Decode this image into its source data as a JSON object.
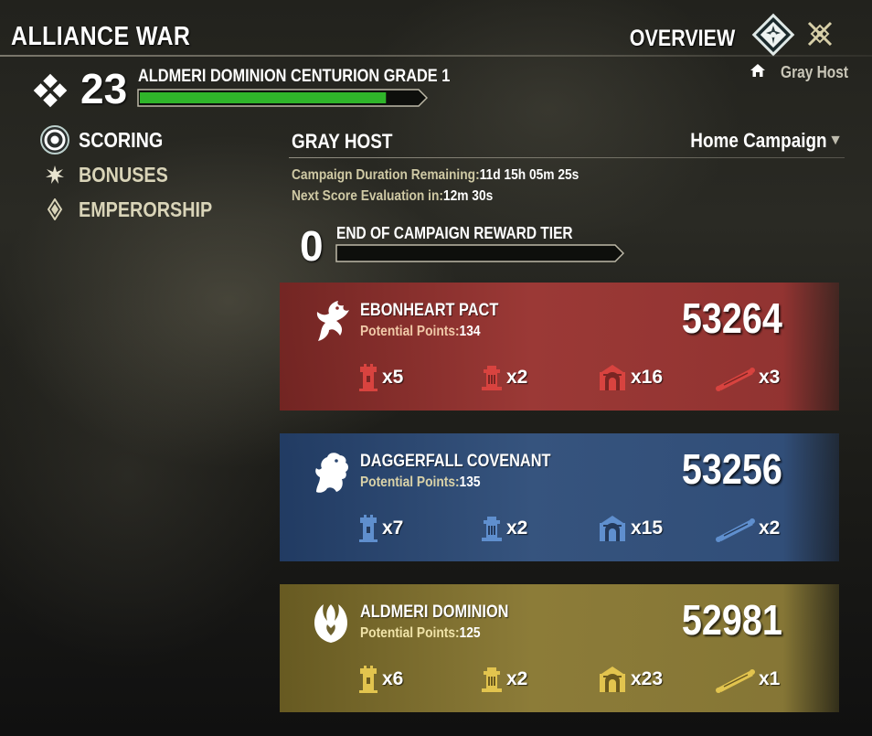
{
  "header": {
    "title": "ALLIANCE WAR",
    "overview_label": "OVERVIEW",
    "overview_icon": "overview-emblem-icon",
    "secondary_icon": "crossed-swords-icon",
    "home_campaign_name": "Gray Host",
    "home_icon": "home-icon"
  },
  "rank": {
    "icon": "rank-diamond-icon",
    "number": "23",
    "title": "ALDMERI DOMINION CENTURION GRADE 1",
    "progress_fraction": 0.88,
    "bar_color": "#2fb52a"
  },
  "nav": {
    "items": [
      {
        "label": "SCORING",
        "icon": "target-icon",
        "active": true
      },
      {
        "label": "BONUSES",
        "icon": "starburst-icon",
        "active": false
      },
      {
        "label": "EMPERORSHIP",
        "icon": "gem-icon",
        "active": false
      }
    ]
  },
  "campaign": {
    "name": "GRAY HOST",
    "selector_label": "Home Campaign",
    "duration_label": "Campaign Duration Remaining:",
    "duration_value": "11d 15h 05m 25s",
    "next_eval_label": "Next Score Evaluation in:",
    "next_eval_value": "12m 30s",
    "reward_tier_number": "0",
    "reward_tier_title": "END OF CAMPAIGN REWARD TIER",
    "reward_progress_fraction": 0
  },
  "alliances": [
    {
      "key": "ep",
      "name": "EBONHEART PACT",
      "potential_label": "Potential Points:",
      "potential_value": "134",
      "score": "53264",
      "crest": "dragon-crest-icon",
      "icon_color": "#d8433f",
      "holdings": {
        "keeps": "x5",
        "outposts": "x2",
        "towns": "x16",
        "scrolls": "x3"
      }
    },
    {
      "key": "dc",
      "name": "DAGGERFALL COVENANT",
      "potential_label": "Potential Points:",
      "potential_value": "135",
      "score": "53256",
      "crest": "lion-crest-icon",
      "icon_color": "#5f8fce",
      "holdings": {
        "keeps": "x7",
        "outposts": "x2",
        "towns": "x15",
        "scrolls": "x2"
      }
    },
    {
      "key": "ad",
      "name": "ALDMERI DOMINION",
      "potential_label": "Potential Points:",
      "potential_value": "125",
      "score": "52981",
      "crest": "eagle-crest-icon",
      "icon_color": "#e2c44e",
      "holdings": {
        "keeps": "x6",
        "outposts": "x2",
        "towns": "x23",
        "scrolls": "x1"
      }
    }
  ]
}
